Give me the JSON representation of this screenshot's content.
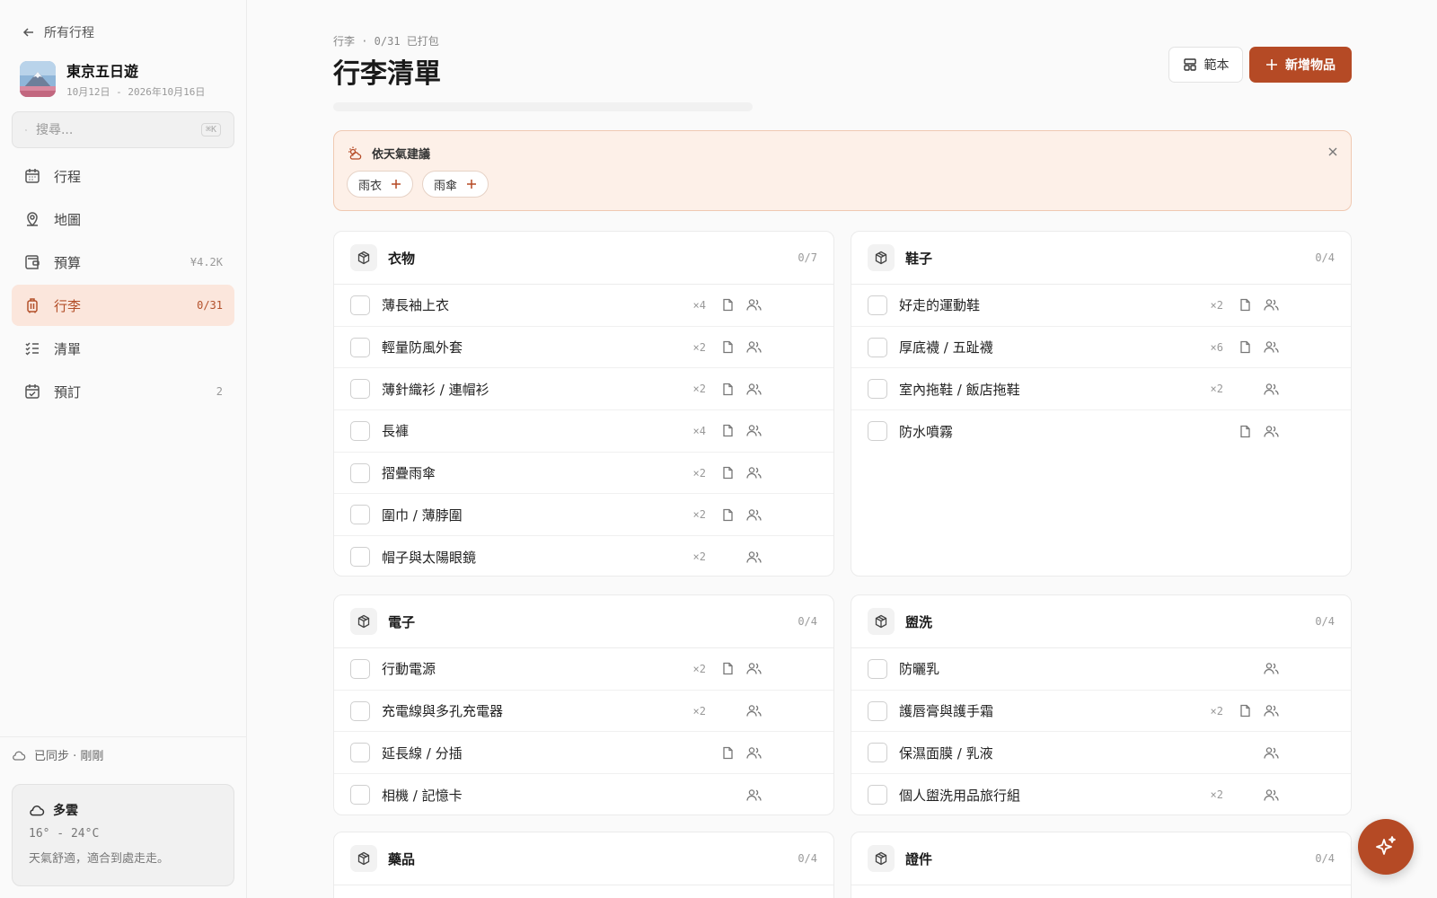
{
  "sidebar": {
    "back_label": "所有行程",
    "trip": {
      "title": "東京五日遊",
      "dates": "10月12日 - 2026年10月16日"
    },
    "search": {
      "placeholder": "搜尋...",
      "shortcut": "⌘K"
    },
    "nav": [
      {
        "label": "行程",
        "badge": "",
        "icon": "calendar-icon"
      },
      {
        "label": "地圖",
        "badge": "",
        "icon": "map-pin-icon"
      },
      {
        "label": "預算",
        "badge": "¥4.2K",
        "icon": "wallet-icon"
      },
      {
        "label": "行李",
        "badge": "0/31",
        "icon": "luggage-icon",
        "active": true
      },
      {
        "label": "清單",
        "badge": "",
        "icon": "checklist-icon"
      },
      {
        "label": "預訂",
        "badge": "2",
        "icon": "calendar-check-icon"
      }
    ],
    "sync_status": "已同步 · 剛剛",
    "weather": {
      "condition": "多雲",
      "temp": "16° - 24°C",
      "note": "天氣舒適，適合到處走走。"
    }
  },
  "header": {
    "meta": "行李 · 0/31 已打包",
    "title": "行李清單",
    "template_label": "範本",
    "add_label": "新增物品",
    "packed_fraction": 0
  },
  "weather_suggest": {
    "title": "依天氣建議",
    "chips": [
      "雨衣",
      "雨傘"
    ]
  },
  "categories": [
    {
      "name": "衣物",
      "count": "0/7",
      "items": [
        {
          "name": "薄長袖上衣",
          "qty": "×4",
          "note": true,
          "share": true
        },
        {
          "name": "輕量防風外套",
          "qty": "×2",
          "note": true,
          "share": true
        },
        {
          "name": "薄針織衫 / 連帽衫",
          "qty": "×2",
          "note": true,
          "share": true
        },
        {
          "name": "長褲",
          "qty": "×4",
          "note": true,
          "share": true
        },
        {
          "name": "摺疊雨傘",
          "qty": "×2",
          "note": true,
          "share": true
        },
        {
          "name": "圍巾 / 薄脖圍",
          "qty": "×2",
          "note": true,
          "share": true
        },
        {
          "name": "帽子與太陽眼鏡",
          "qty": "×2",
          "note": false,
          "share": true
        }
      ]
    },
    {
      "name": "鞋子",
      "count": "0/4",
      "items": [
        {
          "name": "好走的運動鞋",
          "qty": "×2",
          "note": true,
          "share": true
        },
        {
          "name": "厚底襪 / 五趾襪",
          "qty": "×6",
          "note": true,
          "share": true
        },
        {
          "name": "室內拖鞋 / 飯店拖鞋",
          "qty": "×2",
          "note": false,
          "share": true
        },
        {
          "name": "防水噴霧",
          "qty": "",
          "note": true,
          "share": true
        }
      ]
    },
    {
      "name": "電子",
      "count": "0/4",
      "items": [
        {
          "name": "行動電源",
          "qty": "×2",
          "note": true,
          "share": true
        },
        {
          "name": "充電線與多孔充電器",
          "qty": "×2",
          "note": false,
          "share": true
        },
        {
          "name": "延長線 / 分插",
          "qty": "",
          "note": true,
          "share": true
        },
        {
          "name": "相機 / 記憶卡",
          "qty": "",
          "note": false,
          "share": true
        }
      ]
    },
    {
      "name": "盥洗",
      "count": "0/4",
      "items": [
        {
          "name": "防曬乳",
          "qty": "",
          "note": false,
          "share": true
        },
        {
          "name": "護唇膏與護手霜",
          "qty": "×2",
          "note": true,
          "share": true
        },
        {
          "name": "保濕面膜 / 乳液",
          "qty": "",
          "note": false,
          "share": true
        },
        {
          "name": "個人盥洗用品旅行組",
          "qty": "×2",
          "note": false,
          "share": true
        }
      ]
    },
    {
      "name": "藥品",
      "count": "0/4",
      "items": []
    },
    {
      "name": "證件",
      "count": "0/4",
      "items": []
    }
  ],
  "colors": {
    "accent": "#b54a25",
    "accent_soft": "#fbe6dc",
    "suggest_bg": "#fdf0e8"
  }
}
